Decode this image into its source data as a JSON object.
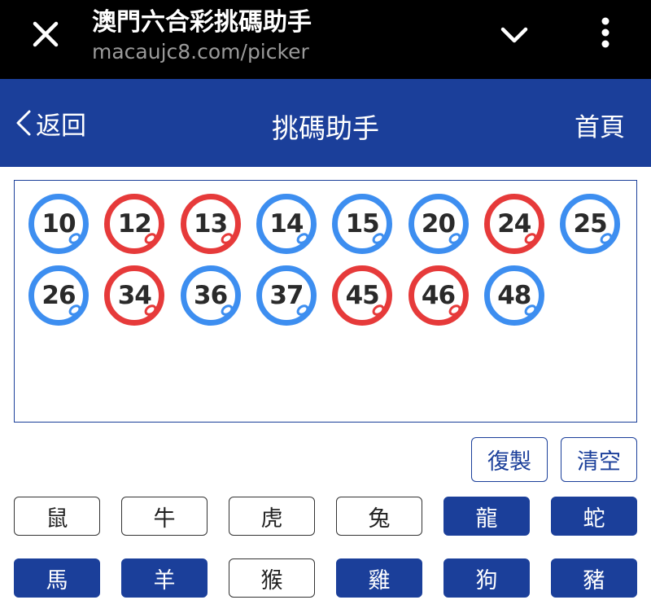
{
  "browser": {
    "title": "澳門六合彩挑碼助手",
    "url": "macaujc8.com/picker",
    "close_icon": "close-icon",
    "expand_icon": "chevron-down-icon",
    "menu_icon": "more-vert-icon"
  },
  "header": {
    "back_label": "返回",
    "title": "挑碼助手",
    "home_label": "首頁",
    "background": "#1b3f9a"
  },
  "balls": [
    {
      "number": "10",
      "color": "blue"
    },
    {
      "number": "12",
      "color": "red"
    },
    {
      "number": "13",
      "color": "red"
    },
    {
      "number": "14",
      "color": "blue"
    },
    {
      "number": "15",
      "color": "blue"
    },
    {
      "number": "20",
      "color": "blue"
    },
    {
      "number": "24",
      "color": "red"
    },
    {
      "number": "25",
      "color": "blue"
    },
    {
      "number": "26",
      "color": "blue"
    },
    {
      "number": "34",
      "color": "red"
    },
    {
      "number": "36",
      "color": "blue"
    },
    {
      "number": "37",
      "color": "blue"
    },
    {
      "number": "45",
      "color": "red"
    },
    {
      "number": "46",
      "color": "red"
    },
    {
      "number": "48",
      "color": "blue"
    }
  ],
  "actions": {
    "copy_label": "復製",
    "clear_label": "清空"
  },
  "zodiac": [
    {
      "label": "鼠",
      "selected": false
    },
    {
      "label": "牛",
      "selected": false
    },
    {
      "label": "虎",
      "selected": false
    },
    {
      "label": "兔",
      "selected": false
    },
    {
      "label": "龍",
      "selected": true
    },
    {
      "label": "蛇",
      "selected": true
    },
    {
      "label": "馬",
      "selected": true
    },
    {
      "label": "羊",
      "selected": true
    },
    {
      "label": "猴",
      "selected": false
    },
    {
      "label": "雞",
      "selected": true
    },
    {
      "label": "狗",
      "selected": true
    },
    {
      "label": "豬",
      "selected": true
    }
  ],
  "colors": {
    "ball_blue": "#3d8ef0",
    "ball_red": "#e63a3a",
    "accent": "#1b3f9a"
  }
}
